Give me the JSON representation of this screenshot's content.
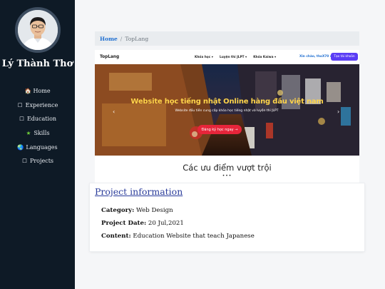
{
  "sidebar": {
    "name": "Lý Thành Thơ",
    "nav": [
      {
        "icon": "home-icon",
        "glyph": "🏠",
        "label": "Home"
      },
      {
        "icon": "experience-icon",
        "glyph": "☐",
        "label": "Experience"
      },
      {
        "icon": "education-icon",
        "glyph": "☐",
        "label": "Education"
      },
      {
        "icon": "star-icon",
        "glyph": "★",
        "label": "Skills"
      },
      {
        "icon": "globe-icon",
        "glyph": "🌏",
        "label": "Languages"
      },
      {
        "icon": "projects-icon",
        "glyph": "☐",
        "label": "Projects"
      }
    ]
  },
  "breadcrumb": {
    "home": "Home",
    "separator": "/",
    "current": "TopLang"
  },
  "screenshot": {
    "logo": "TopLang",
    "menu": [
      "Khóa học ▾",
      "Luyện thi JLPT ▾",
      "Khóa Kaiwa ▾"
    ],
    "greeting": "Xin chào, thoX70 ▾",
    "signup": "Tạo tài khoản",
    "hero_title": "Website học tiếng nhật Online hàng đầu việt nam",
    "hero_sub": "Website đầu tiên cung cấp khóa học tiếng nhật và luyện thi JLPT",
    "hero_cta": "Đăng ký học ngay →",
    "section_title": "Các ưu điểm vượt trội",
    "section_dots": "•••",
    "accent": "#5b3df5",
    "cta_color": "#e6253a"
  },
  "project": {
    "title": "Project information",
    "category_label": "Category:",
    "category": "Web Design",
    "date_label": "Project Date:",
    "date": "20 Jul,2021",
    "content_label": "Content:",
    "content": "Education Website that teach Japanese"
  }
}
